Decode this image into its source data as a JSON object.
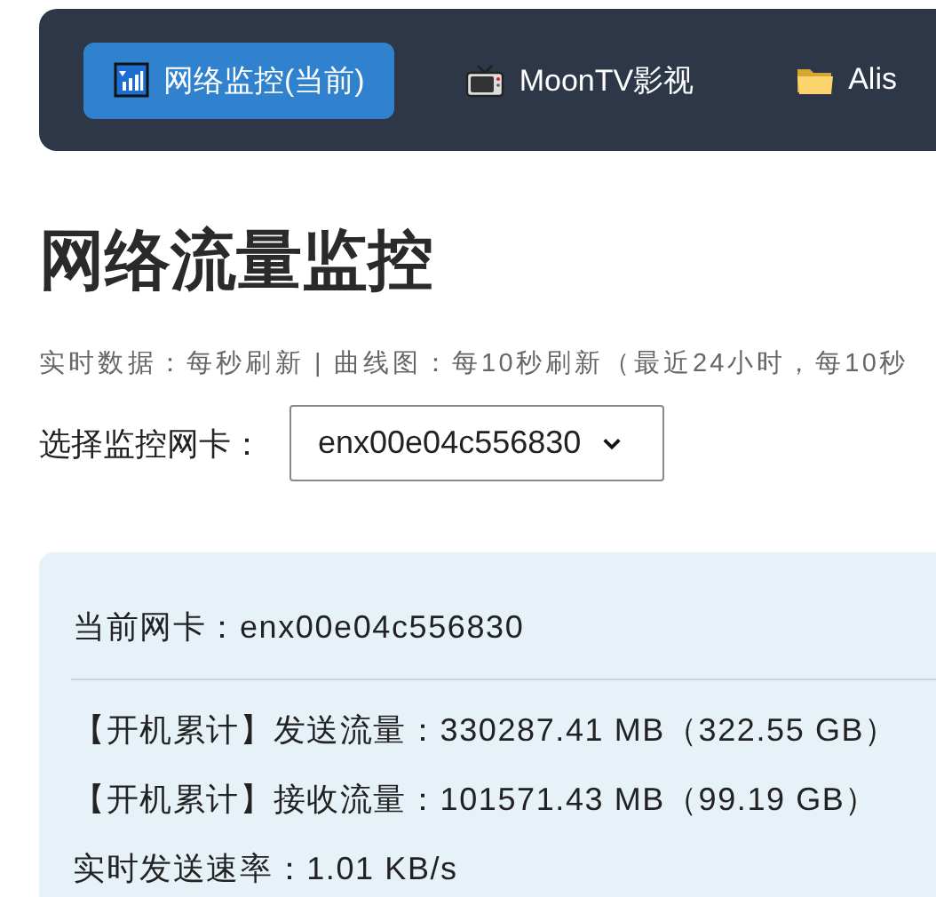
{
  "nav": {
    "tabs": [
      {
        "label": "网络监控(当前)",
        "kind": "signal",
        "selected": true
      },
      {
        "label": "MoonTV影视",
        "kind": "tv",
        "selected": false
      },
      {
        "label": "Alis",
        "kind": "folder",
        "selected": false
      }
    ]
  },
  "heading": "网络流量监控",
  "subtitle": "实时数据：每秒刷新 | 曲线图：每10秒刷新（最近24小时，每10秒",
  "selector": {
    "label": "选择监控网卡：",
    "value": "enx00e04c556830"
  },
  "card": {
    "current": "当前网卡：enx00e04c556830",
    "lines": [
      "【开机累计】发送流量：330287.41 MB（322.55 GB）",
      "【开机累计】接收流量：101571.43 MB（99.19 GB）",
      "实时发送速率：1.01 KB/s"
    ]
  }
}
